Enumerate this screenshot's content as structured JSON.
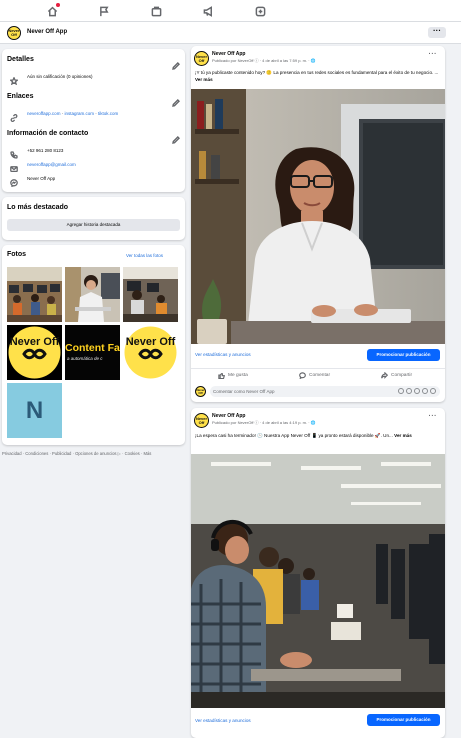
{
  "page": {
    "name": "Never Off App",
    "logo_text": "Never Off",
    "more_label": "···"
  },
  "details": {
    "title": "Detalles",
    "rating": "Aún sin calificación (0 opiniones)"
  },
  "links": {
    "title": "Enlaces",
    "items": [
      "neveroffapp.com",
      "instagram.com",
      "tiktok.com"
    ],
    "separator": " · "
  },
  "contact": {
    "title": "Información de contacto",
    "phone": "+52 961 280 8123",
    "email": "neveroffapp@gmail.com",
    "messenger": "Never Off App"
  },
  "featured": {
    "title": "Lo más destacado",
    "button": "Agregar historia destacada"
  },
  "photos": {
    "title": "Fotos",
    "see_all": "Ver todas las fotos",
    "content_text": "Content Fa",
    "content_sub": "a automática de c",
    "n_letter": "N"
  },
  "footer": "Privacidad · Condiciones · Publicidad · Opciones de anuncios ▷ · Cookies · Más",
  "posts": [
    {
      "author": "Never Off App",
      "sub": "Publicado por NeverOff ⓘ · 4 de abril a las 7:59 p. m. · 🌐",
      "text": "¡Y tú ya publicaste contenido hoy? 😕 La presencia en tus redes sociales es fundamental para el éxito de tu negocio. ... ",
      "more": "Ver más",
      "stats": "Ver estadísticas y anuncios",
      "promote": "Promocionar publicación",
      "like": "Me gusta",
      "comment": "Comentar",
      "share": "Compartir",
      "comment_placeholder": "Comentar como Never Off App"
    },
    {
      "author": "Never Off App",
      "sub": "Publicado por NeverOff ⓘ · 4 de abril a las 4:19 p. m. · 🌐",
      "text": "¡La espera casi ha terminado! 🕓 Nuestra App Never Off 📱 ya pronto estará disponible 🚀. Un... ",
      "more": "Ver más",
      "stats": "Ver estadísticas y anuncios",
      "promote": "Promocionar publicación"
    }
  ],
  "colors": {
    "accent": "#0866ff",
    "link": "#216fdb",
    "brand_yellow": "#ffe14a"
  }
}
